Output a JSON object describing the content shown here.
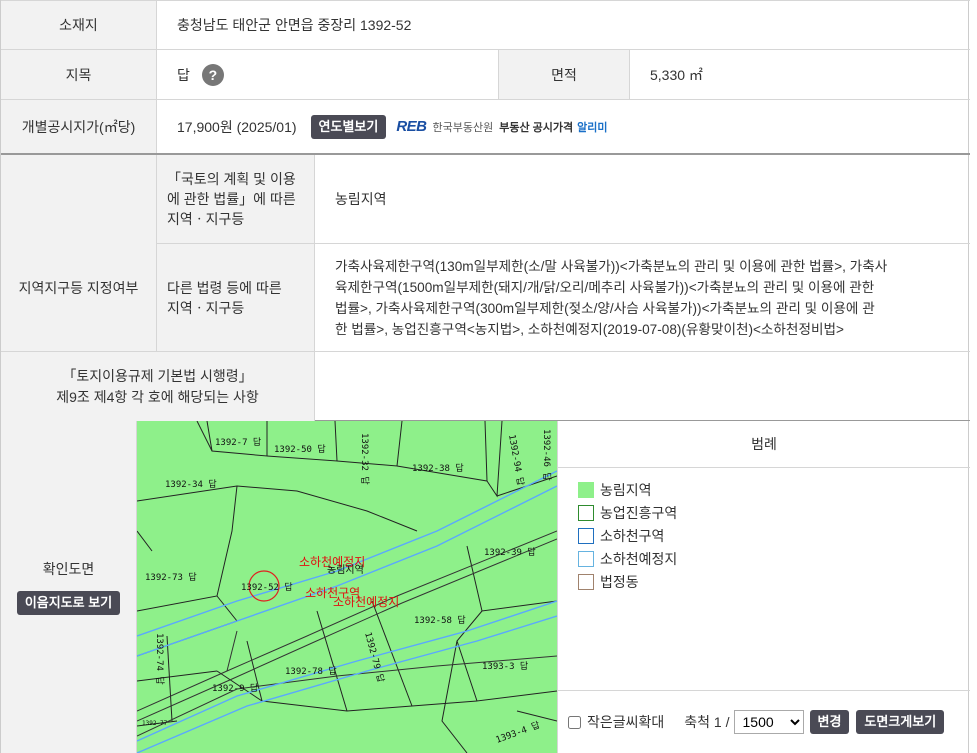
{
  "location": {
    "label": "소재지",
    "value": "충청남도 태안군 안면읍 중장리 1392-52"
  },
  "landcat": {
    "label": "지목",
    "value": "답",
    "help": "?",
    "area_label": "면적",
    "area_value": "5,330 ㎡"
  },
  "price": {
    "label": "개별공시지가(㎡당)",
    "value": "17,900원 (2025/01)",
    "button": "연도별보기",
    "reb_logo": "REB",
    "reb_org": "한국부동산원",
    "reb_service": "부동산 공시가격",
    "reb_app": "알리미"
  },
  "zone": {
    "label": "지역지구등 지정여부",
    "sub1_label_line1": "「국토의 계획 및 이용",
    "sub1_label_line2": "에 관한 법률」에 따른",
    "sub1_label_line3": "지역ㆍ지구등",
    "sub1_value": "농림지역",
    "sub2_label_line1": "다른 법령 등에 따른",
    "sub2_label_line2": "지역ㆍ지구등",
    "sub2_line1": "가축사육제한구역(130m일부제한(소/말 사육불가))<가축분뇨의 관리 및 이용에 관한 법률>, 가축사",
    "sub2_line2": "육제한구역(1500m일부제한(돼지/개/닭/오리/메추리 사육불가))<가축분뇨의 관리 및 이용에 관한",
    "sub2_line3": "법률>, 가축사육제한구역(300m일부제한(젖소/양/사슴 사육불가))<가축분뇨의 관리 및 이용에 관",
    "sub2_line4": "한 법률>, 농업진흥구역<농지법>, 소하천예정지(2019-07-08)(유황맞이천)<소하천정비법>"
  },
  "regulation": {
    "label_line1": "「토지이용규제 기본법 시행령」",
    "label_line2": "제9조 제4항 각 호에 해당되는 사항",
    "value": ""
  },
  "map": {
    "label": "확인도면",
    "button": "이음지도로 보기",
    "parcels": [
      "1392-7 답",
      "1392-50 답",
      "1392-32 답",
      "1392-38 답",
      "1392-94 답",
      "1392-46 답",
      "1392-34 답",
      "1392-39 답",
      "1392-73 답",
      "1392-52 답",
      "1392-58 답",
      "1392-74 답",
      "1392-79 답",
      "1392-78 답",
      "1393-3 답",
      "1392-9 답",
      "1393-4 답",
      "1392-77"
    ],
    "overlay_labels": [
      "소하천예정지",
      "농림지역",
      "소하천구역",
      "소하천예정지"
    ]
  },
  "legend": {
    "title": "범례",
    "items": [
      {
        "label": "농림지역",
        "color": "#8ef08a",
        "border": "#8ef08a"
      },
      {
        "label": "농업진흥구역",
        "color": "#ffffff",
        "border": "#2e8b2e"
      },
      {
        "label": "소하천구역",
        "color": "#ffffff",
        "border": "#1f6fbf"
      },
      {
        "label": "소하천예정지",
        "color": "#ffffff",
        "border": "#66b3e0"
      },
      {
        "label": "법정동",
        "color": "#ffffff",
        "border": "#a0826d"
      }
    ]
  },
  "controls": {
    "small_text_label": "작은글씨확대",
    "scale_label": "축척 1 /",
    "scale_value": "1500",
    "change_button": "변경",
    "enlarge_button": "도면크게보기"
  }
}
